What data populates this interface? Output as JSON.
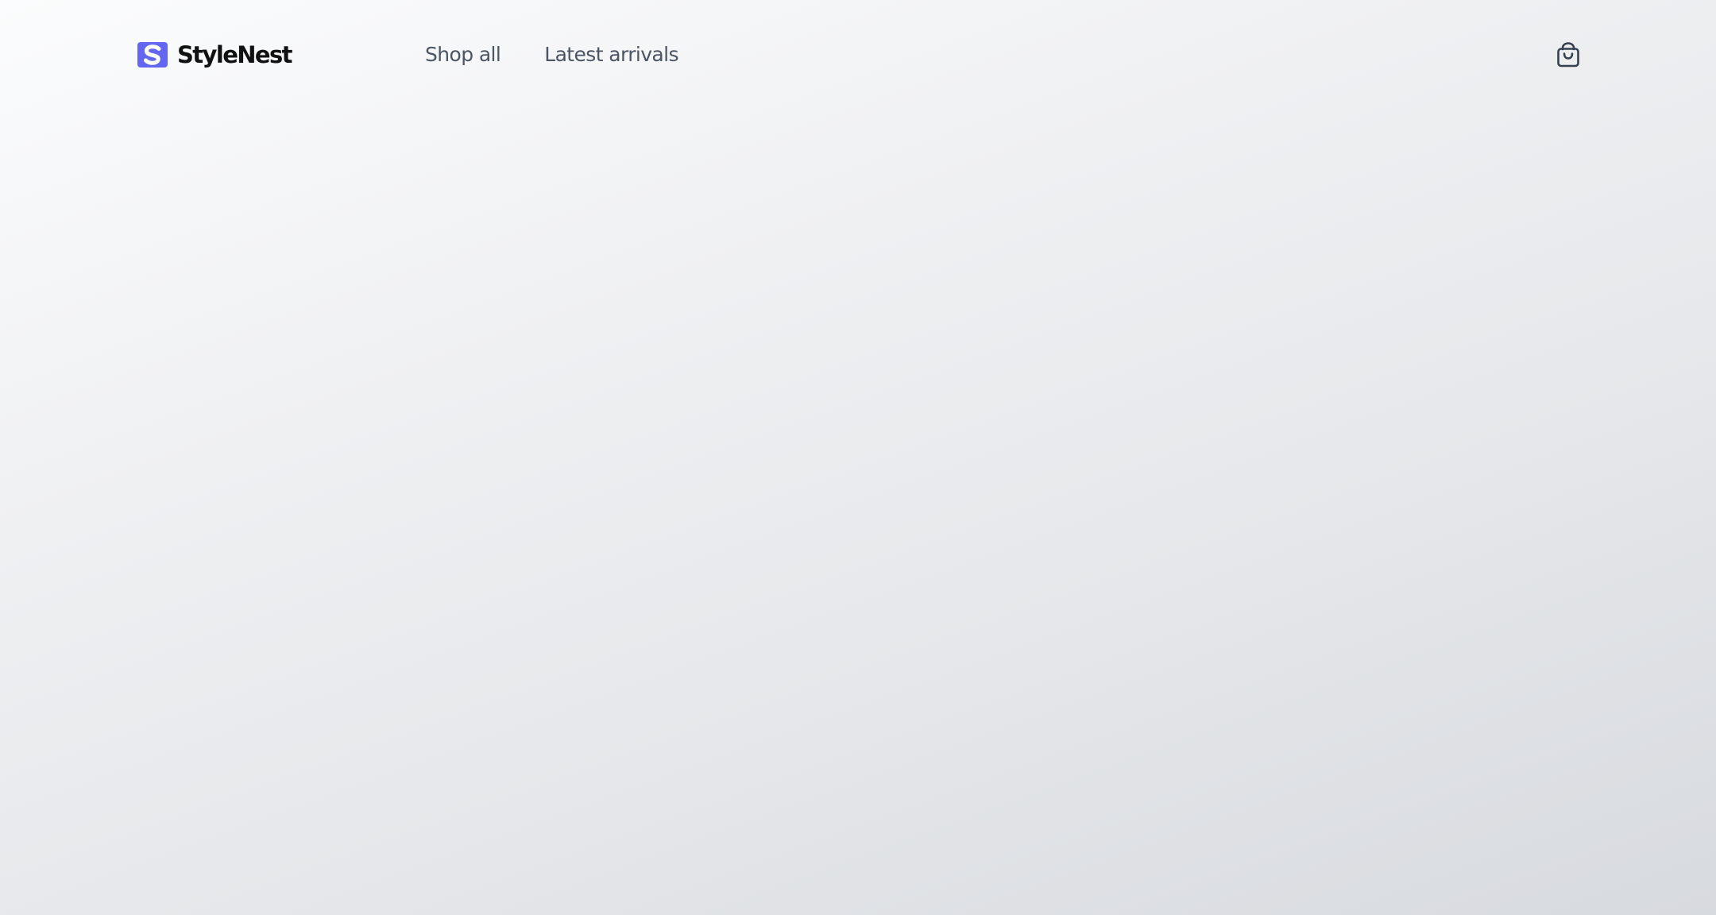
{
  "brand": {
    "name": "StyleNest",
    "logo_icon": "s-logo-icon",
    "accent_color": "#6366f1"
  },
  "nav": {
    "items": [
      {
        "label": "Shop all"
      },
      {
        "label": "Latest arrivals"
      }
    ]
  },
  "cart": {
    "icon": "shopping-bag-icon"
  }
}
